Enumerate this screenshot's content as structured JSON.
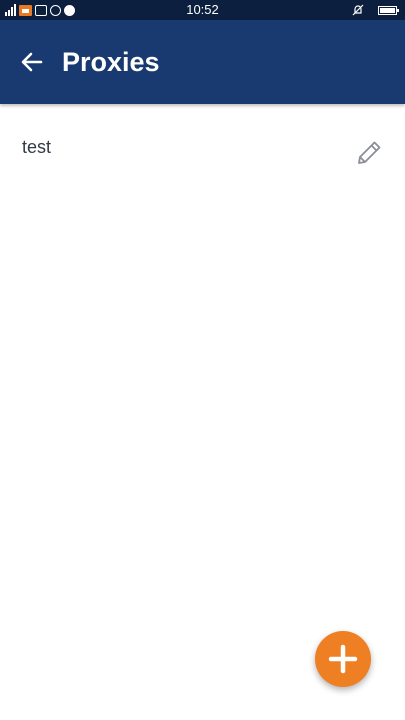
{
  "status_bar": {
    "time": "10:52"
  },
  "app_bar": {
    "title": "Proxies",
    "icons": {
      "back": "arrow-left-icon"
    }
  },
  "proxies": {
    "items": [
      {
        "label": "test",
        "action_icon": "pencil-icon"
      }
    ]
  },
  "fab": {
    "icon": "plus-icon"
  },
  "colors": {
    "status_bar": "#0c1f3e",
    "app_bar": "#183a70",
    "accent": "#ee7f22",
    "text": "#333a45",
    "icon_grey": "#8a8f98"
  }
}
